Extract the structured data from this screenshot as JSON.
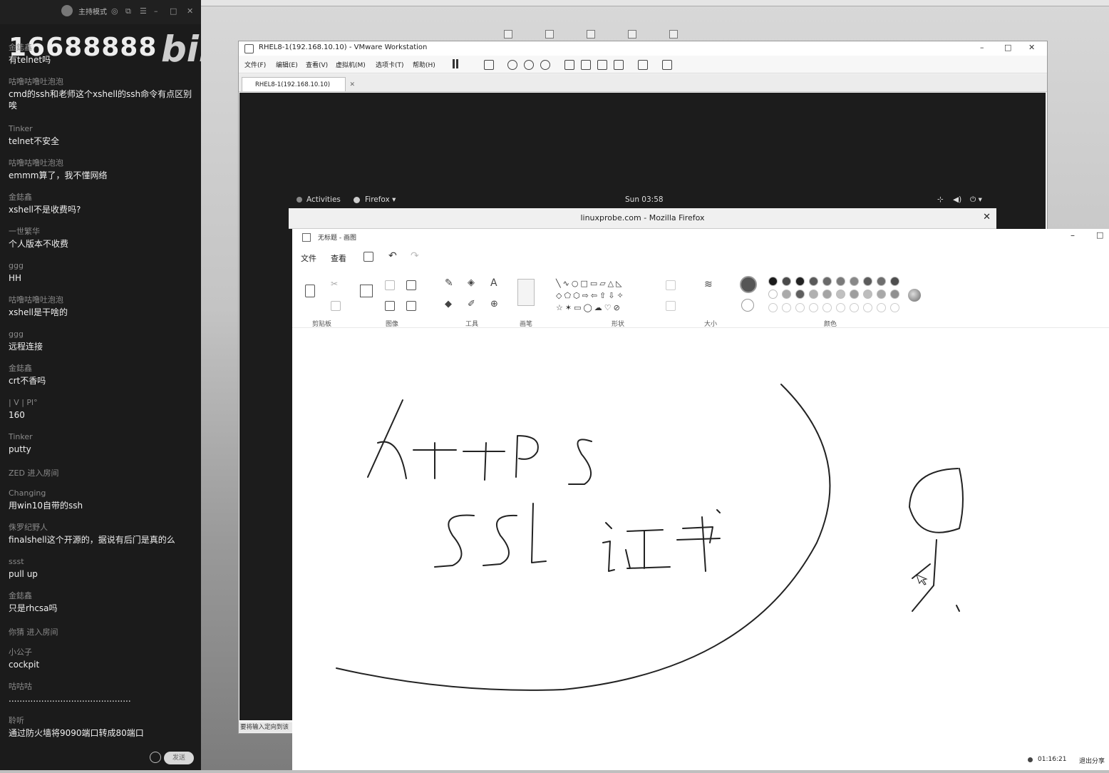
{
  "chat": {
    "mode_label": "主持模式",
    "watermark_number": "16688888",
    "watermark_logo": "bilibili",
    "messages": [
      {
        "name": "金鋕鑫",
        "text": "有telnet吗"
      },
      {
        "name": "咕噜咕噜吐泡泡",
        "text": "cmd的ssh和老师这个xshell的ssh命令有点区别唉"
      },
      {
        "name": "Tinker",
        "text": "telnet不安全"
      },
      {
        "name": "咕噜咕噜吐泡泡",
        "text": "emmm算了，我不懂网络"
      },
      {
        "name": "金鋕鑫",
        "text": "xshell不是收费吗?"
      },
      {
        "name": "一世繁华",
        "text": "个人版本不收费"
      },
      {
        "name": "ggg",
        "text": "HH"
      },
      {
        "name": "咕噜咕噜吐泡泡",
        "text": "xshell是干啥的"
      },
      {
        "name": "ggg",
        "text": "远程连接"
      },
      {
        "name": "金鋕鑫",
        "text": "crt不香吗"
      },
      {
        "name": "|  V  |  Pl°",
        "text": "160"
      },
      {
        "name": "Tinker",
        "text": "putty"
      }
    ],
    "system_1": "ZED 进入房间",
    "messages2": [
      {
        "name": "Changing",
        "text": "用win10自带的ssh"
      },
      {
        "name": "侏罗纪野人",
        "text": "finalshell这个开源的，据说有后门是真的么"
      },
      {
        "name": "ssst",
        "text": "pull up"
      },
      {
        "name": "金鋕鑫",
        "text": "只是rhcsa吗"
      }
    ],
    "system_2": "你猜 进入房间",
    "messages3": [
      {
        "name": "小公子",
        "text": "cockpit"
      },
      {
        "name": "咕咕咕",
        "text": "............................................."
      },
      {
        "name": "聆听",
        "text": "通过防火墙将9090端口转成80端口"
      }
    ],
    "input_placeholder": "发送"
  },
  "vmware": {
    "title": "RHEL8-1(192.168.10.10) - VMware Workstation",
    "menus": [
      "文件(F)",
      "编辑(E)",
      "查看(V)",
      "虚拟机(M)",
      "选项卡(T)",
      "帮助(H)"
    ],
    "tab_label": "RHEL8-1(192.168.10.10)",
    "status_text": "要将输入定向到该"
  },
  "gnome": {
    "activities": "Activities",
    "app": "Firefox ▾",
    "clock": "Sun 03:58"
  },
  "firefox": {
    "title": "linuxprobe.com - Mozilla Firefox"
  },
  "paint": {
    "title": "无标题 - 画图",
    "menus": [
      "文件",
      "查看"
    ],
    "groups": [
      "剪贴板",
      "图像",
      "工具",
      "画笔",
      "形状",
      "大小",
      "颜色"
    ],
    "status_time": "01:16:21",
    "status_exit": "退出分享",
    "palette_row1": [
      "#1a1a1a",
      "#4a4a4a",
      "#222222",
      "#5a5a5a",
      "#6a6a6a",
      "#7a7a7a",
      "#888888",
      "#5c5c5c",
      "#6e6e6e",
      "#4e4e4e",
      "#7e7e7e"
    ],
    "palette_row2": [
      "#ffffff",
      "#aaaaaa",
      "#5e5e5e",
      "#b0b0b0",
      "#a4a4a4",
      "#c0c0c0",
      "#9e9e9e",
      "#bdbdbd",
      "#a8a8a8",
      "#909090",
      "#cfcfcf"
    ]
  },
  "drawing": {
    "word1": "HTTPS",
    "word2": "SSL 证书"
  }
}
